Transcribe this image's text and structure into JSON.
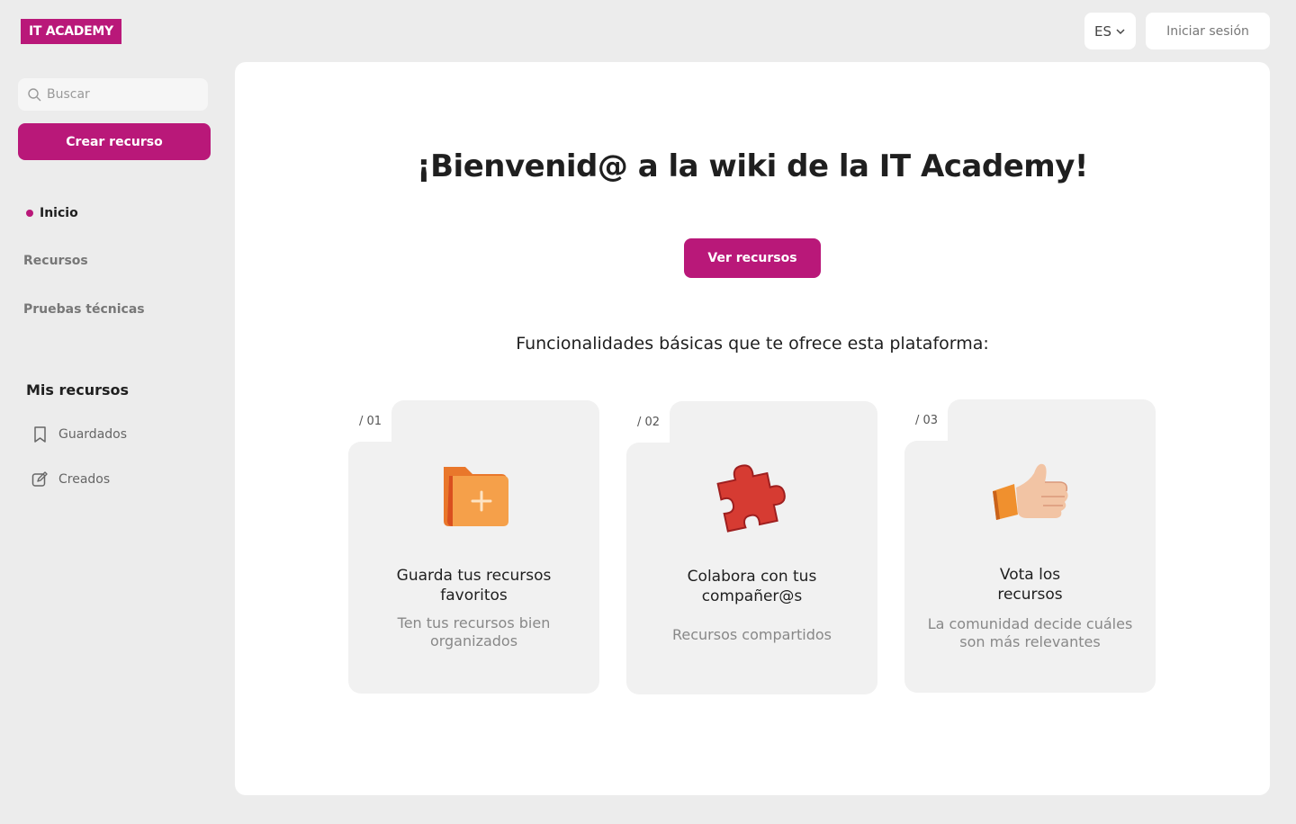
{
  "header": {
    "logo_text": "IT ACADEMY",
    "language": "ES",
    "login_label": "Iniciar sesión"
  },
  "sidebar": {
    "search_placeholder": "Buscar",
    "create_label": "Crear recurso",
    "nav": [
      {
        "label": "Inicio",
        "active": true
      },
      {
        "label": "Recursos",
        "active": false
      },
      {
        "label": "Pruebas técnicas",
        "active": false
      }
    ],
    "my_resources_title": "Mis recursos",
    "my_resources": [
      {
        "label": "Guardados",
        "icon": "bookmark-icon"
      },
      {
        "label": "Creados",
        "icon": "edit-icon"
      }
    ]
  },
  "main": {
    "title": "¡Bienvenid@ a la wiki de la IT Academy!",
    "view_button": "Ver recursos",
    "subtitle": "Funcionalidades básicas que te ofrece esta plataforma:",
    "cards": [
      {
        "number": "/ 01",
        "icon": "folder-plus-icon",
        "title_line1": "Guarda tus recursos",
        "title_line2": "favoritos",
        "desc_line1": "Ten tus recursos bien",
        "desc_line2": "organizados"
      },
      {
        "number": "/ 02",
        "icon": "puzzle-icon",
        "title_line1": "Colabora con tus",
        "title_line2": "compañer@s",
        "desc_line1": "Recursos compartidos",
        "desc_line2": ""
      },
      {
        "number": "/ 03",
        "icon": "thumbs-up-icon",
        "title_line1": "Vota los",
        "title_line2": "recursos",
        "desc_line1": "La comunidad decide cuáles",
        "desc_line2": "son más relevantes"
      }
    ]
  },
  "colors": {
    "accent": "#b91879",
    "background": "#ececec",
    "card": "#f1f1f1"
  }
}
